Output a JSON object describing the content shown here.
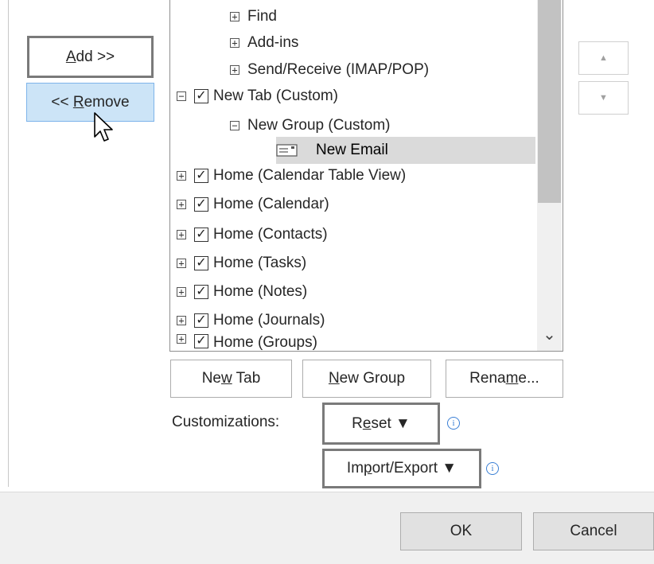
{
  "buttons": {
    "add": {
      "pre": "",
      "u": "A",
      "post": "dd >>"
    },
    "remove": {
      "pre": "<< ",
      "u": "R",
      "post": "emove"
    },
    "move_up_glyph": "▲",
    "move_down_glyph": "▼"
  },
  "tree": {
    "rows": [
      {
        "label": "Find",
        "expander": "+",
        "checked": null
      },
      {
        "label": "Add-ins",
        "expander": "+",
        "checked": null
      },
      {
        "label": "Send/Receive (IMAP/POP)",
        "expander": "+",
        "checked": null
      },
      {
        "label": "New Tab (Custom)",
        "expander": "−",
        "checked": true
      },
      {
        "label": "New Group (Custom)",
        "expander": "−",
        "checked": null
      },
      {
        "label": "New Email",
        "expander": null,
        "checked": null,
        "selected": true
      },
      {
        "label": "Home (Calendar Table View)",
        "expander": "+",
        "checked": true
      },
      {
        "label": "Home (Calendar)",
        "expander": "+",
        "checked": true
      },
      {
        "label": "Home (Contacts)",
        "expander": "+",
        "checked": true
      },
      {
        "label": "Home (Tasks)",
        "expander": "+",
        "checked": true
      },
      {
        "label": "Home (Notes)",
        "expander": "+",
        "checked": true
      },
      {
        "label": "Home (Journals)",
        "expander": "+",
        "checked": true
      },
      {
        "label": "Home (Groups)",
        "expander": "+",
        "checked": true
      }
    ],
    "check_glyph": "✓",
    "scroll_down_glyph": "⌄"
  },
  "tree_buttons": {
    "new_tab": {
      "pre": "Ne",
      "u": "w",
      "post": " Tab"
    },
    "new_group": {
      "pre": "",
      "u": "N",
      "post": "ew Group"
    },
    "rename": {
      "pre": "Rena",
      "u": "m",
      "post": "e..."
    }
  },
  "customizations": {
    "label": "Customizations:",
    "reset": {
      "pre": "R",
      "u": "e",
      "post": "set ▼"
    },
    "import_export": {
      "pre": "Im",
      "u": "p",
      "post": "ort/Export ▼"
    },
    "info_glyph": "i"
  },
  "footer": {
    "ok": "OK",
    "cancel": "Cancel"
  },
  "colors": {
    "selected_button_bg": "#cce4f7",
    "selected_row_bg": "#dadada",
    "info_icon": "#3a7fd5"
  }
}
